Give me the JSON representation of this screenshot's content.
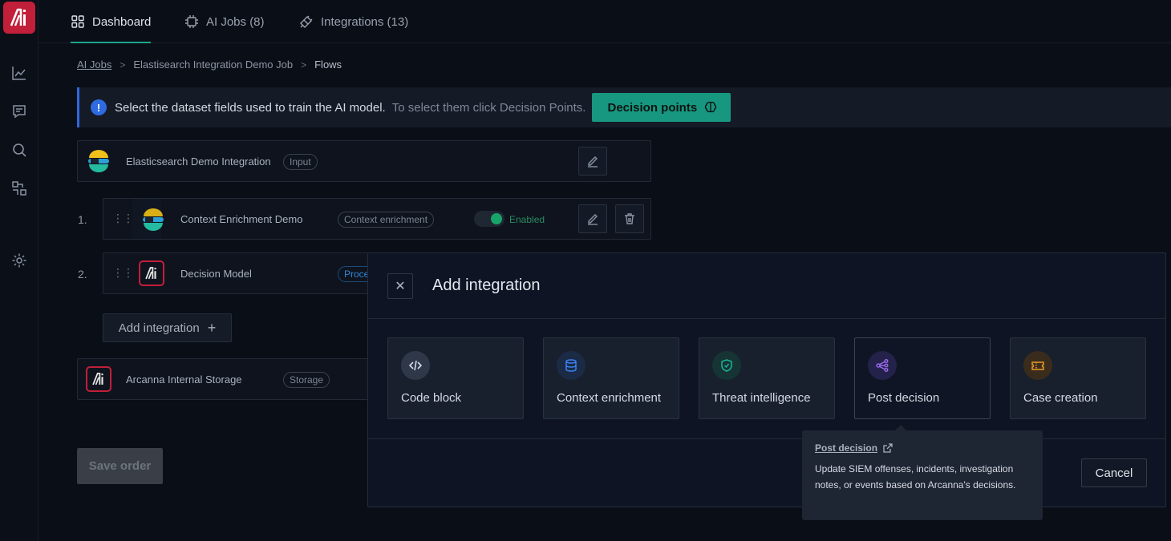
{
  "app": {
    "logo_text": "AI"
  },
  "nav": {
    "tabs": [
      {
        "label": "Dashboard",
        "icon": "grid-icon"
      },
      {
        "label": "AI Jobs (8)",
        "icon": "chip-icon"
      },
      {
        "label": "Integrations (13)",
        "icon": "plug-icon"
      }
    ]
  },
  "rail": {
    "icons": [
      "chart-icon",
      "chat-icon",
      "search-icon",
      "flow-icon",
      "gear-icon"
    ]
  },
  "breadcrumb": {
    "items": [
      "AI Jobs",
      "Elastisearch Integration Demo Job",
      "Flows"
    ],
    "separator": ">"
  },
  "banner": {
    "primary": "Select the dataset fields used to train the AI model.",
    "secondary": "To select them click Decision Points.",
    "button_label": "Decision points"
  },
  "flows": {
    "input": {
      "title": "Elasticsearch Demo Integration",
      "tag": "Input"
    },
    "steps": [
      {
        "number": "1.",
        "title": "Context Enrichment Demo",
        "tag": "Context enrichment",
        "status": "Enabled"
      },
      {
        "number": "2.",
        "title": "Decision Model",
        "tag": "Proce"
      }
    ],
    "add_label": "Add integration",
    "storage": {
      "title": "Arcanna Internal Storage",
      "tag": "Storage"
    },
    "save_label": "Save order"
  },
  "modal": {
    "title": "Add integration",
    "options": [
      {
        "label": "Code block",
        "icon": "code-icon",
        "color": "#c9d0dc"
      },
      {
        "label": "Context enrichment",
        "icon": "database-icon",
        "color": "#3b82f6"
      },
      {
        "label": "Threat intelligence",
        "icon": "shield-icon",
        "color": "#1fb39a"
      },
      {
        "label": "Post decision",
        "icon": "share-nodes-icon",
        "color": "#9b6cf0"
      },
      {
        "label": "Case creation",
        "icon": "ticket-icon",
        "color": "#e79a27"
      }
    ],
    "cancel_label": "Cancel"
  },
  "tooltip": {
    "title": "Post decision",
    "body": "Update SIEM offenses, incidents, investigation notes, or events based on Arcanna's decisions."
  },
  "colors": {
    "accent": "#17977f",
    "brand": "#c21f3a",
    "info": "#2e6ae0"
  }
}
